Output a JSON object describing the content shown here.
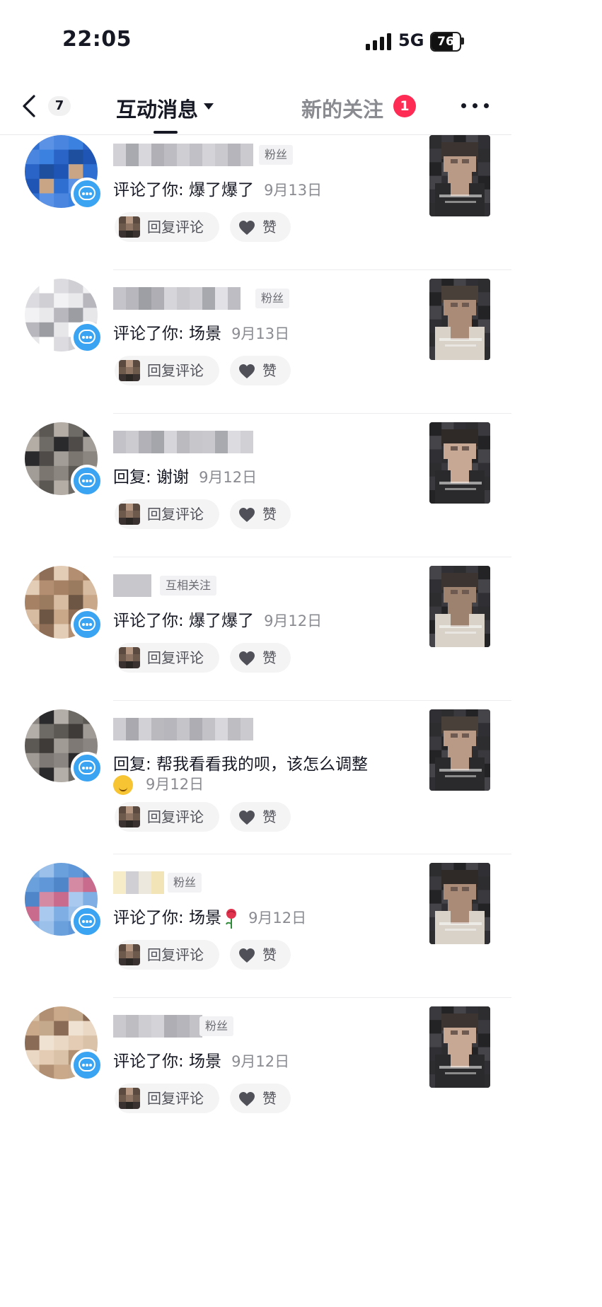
{
  "status_bar": {
    "time": "22:05",
    "network": "5G",
    "battery": "76"
  },
  "nav": {
    "back_count": "7",
    "active_tab": "互动消息",
    "follow_tab": "新的关注",
    "follow_badge": "1"
  },
  "actions": {
    "reply_label": "回复评论",
    "like_label": "赞"
  },
  "messages": [
    {
      "tag": "粉丝",
      "text": "评论了你: 爆了爆了",
      "date": "9月13日"
    },
    {
      "tag": "粉丝",
      "text": "评论了你: 场景",
      "date": "9月13日"
    },
    {
      "tag": "",
      "text": "回复: 谢谢",
      "date": "9月12日"
    },
    {
      "tag": "互相关注",
      "text": "评论了你: 爆了爆了",
      "date": "9月12日"
    },
    {
      "tag": "",
      "text": "回复: 帮我看看我的呗，该怎么调整",
      "date": "9月12日"
    },
    {
      "tag": "粉丝",
      "text": "评论了你: 场景",
      "date": "9月12日"
    },
    {
      "tag": "粉丝",
      "text": "评论了你: 场景",
      "date": "9月12日"
    }
  ],
  "colors": {
    "accent_badge": "#fe2c55",
    "comment_badge": "#3aa4f3",
    "text_primary": "#161823",
    "text_secondary": "#8a8b91"
  }
}
